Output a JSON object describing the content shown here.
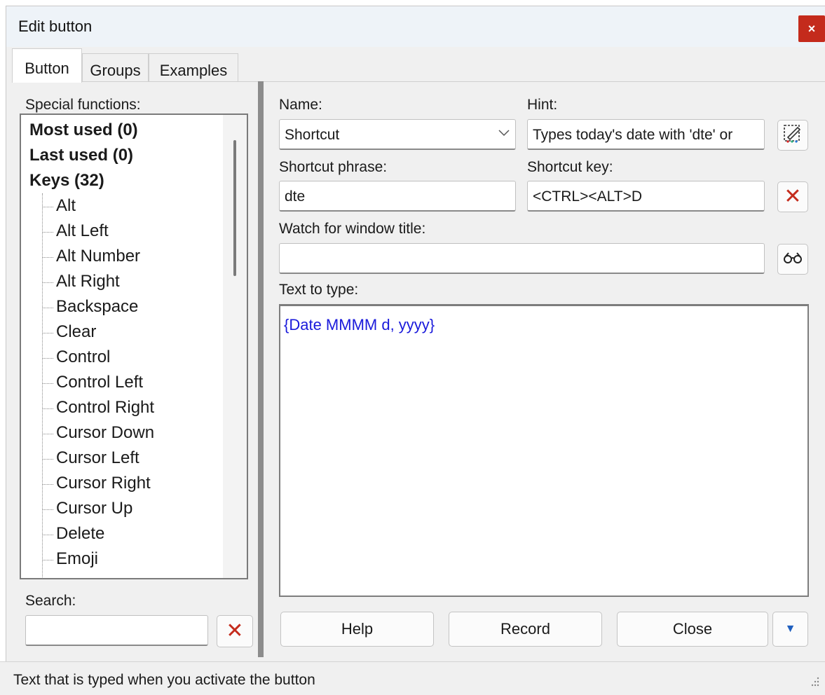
{
  "window": {
    "title": "Edit button",
    "close_glyph": "×"
  },
  "tabs": [
    {
      "label": "Button",
      "active": true
    },
    {
      "label": "Groups",
      "active": false
    },
    {
      "label": "Examples",
      "active": false
    }
  ],
  "left_panel": {
    "special_functions_label": "Special functions:",
    "groups": [
      {
        "label": "Most used (0)"
      },
      {
        "label": "Last used (0)"
      },
      {
        "label": "Keys (32)"
      }
    ],
    "keys": [
      "Alt",
      "Alt Left",
      "Alt Number",
      "Alt Right",
      "Backspace",
      "Clear",
      "Control",
      "Control Left",
      "Control Right",
      "Cursor Down",
      "Cursor Left",
      "Cursor Right",
      "Cursor Up",
      "Delete",
      "Emoji"
    ],
    "search_label": "Search:",
    "search_value": "",
    "clear_search_glyph": "✕"
  },
  "form": {
    "name_label": "Name:",
    "name_value": "Shortcut",
    "hint_label": "Hint:",
    "hint_value": "Types today's date with 'dte' or",
    "shortcut_phrase_label": "Shortcut phrase:",
    "shortcut_phrase_value": "dte",
    "shortcut_key_label": "Shortcut key:",
    "shortcut_key_value": "<CTRL><ALT>D",
    "clear_key_glyph": "✕",
    "watch_label": "Watch for window title:",
    "watch_value": "",
    "text_to_type_label": "Text to type:",
    "text_to_type_value": "{Date MMMM d, yyyy}"
  },
  "buttons": {
    "help": "Help",
    "record": "Record",
    "close": "Close",
    "more_glyph": "▼"
  },
  "status_bar": {
    "text": "Text that is typed when you activate the button"
  },
  "colors": {
    "accent_red": "#c42b1c",
    "macro_text_blue": "#1a1adb",
    "close_button_red": "#c42b1c"
  },
  "icons": {
    "hint_editor": "edit-hint-icon",
    "find_window": "glasses-icon",
    "clear": "red-x-icon",
    "dropdown": "chevron-down-icon",
    "more": "triangle-down-icon"
  }
}
